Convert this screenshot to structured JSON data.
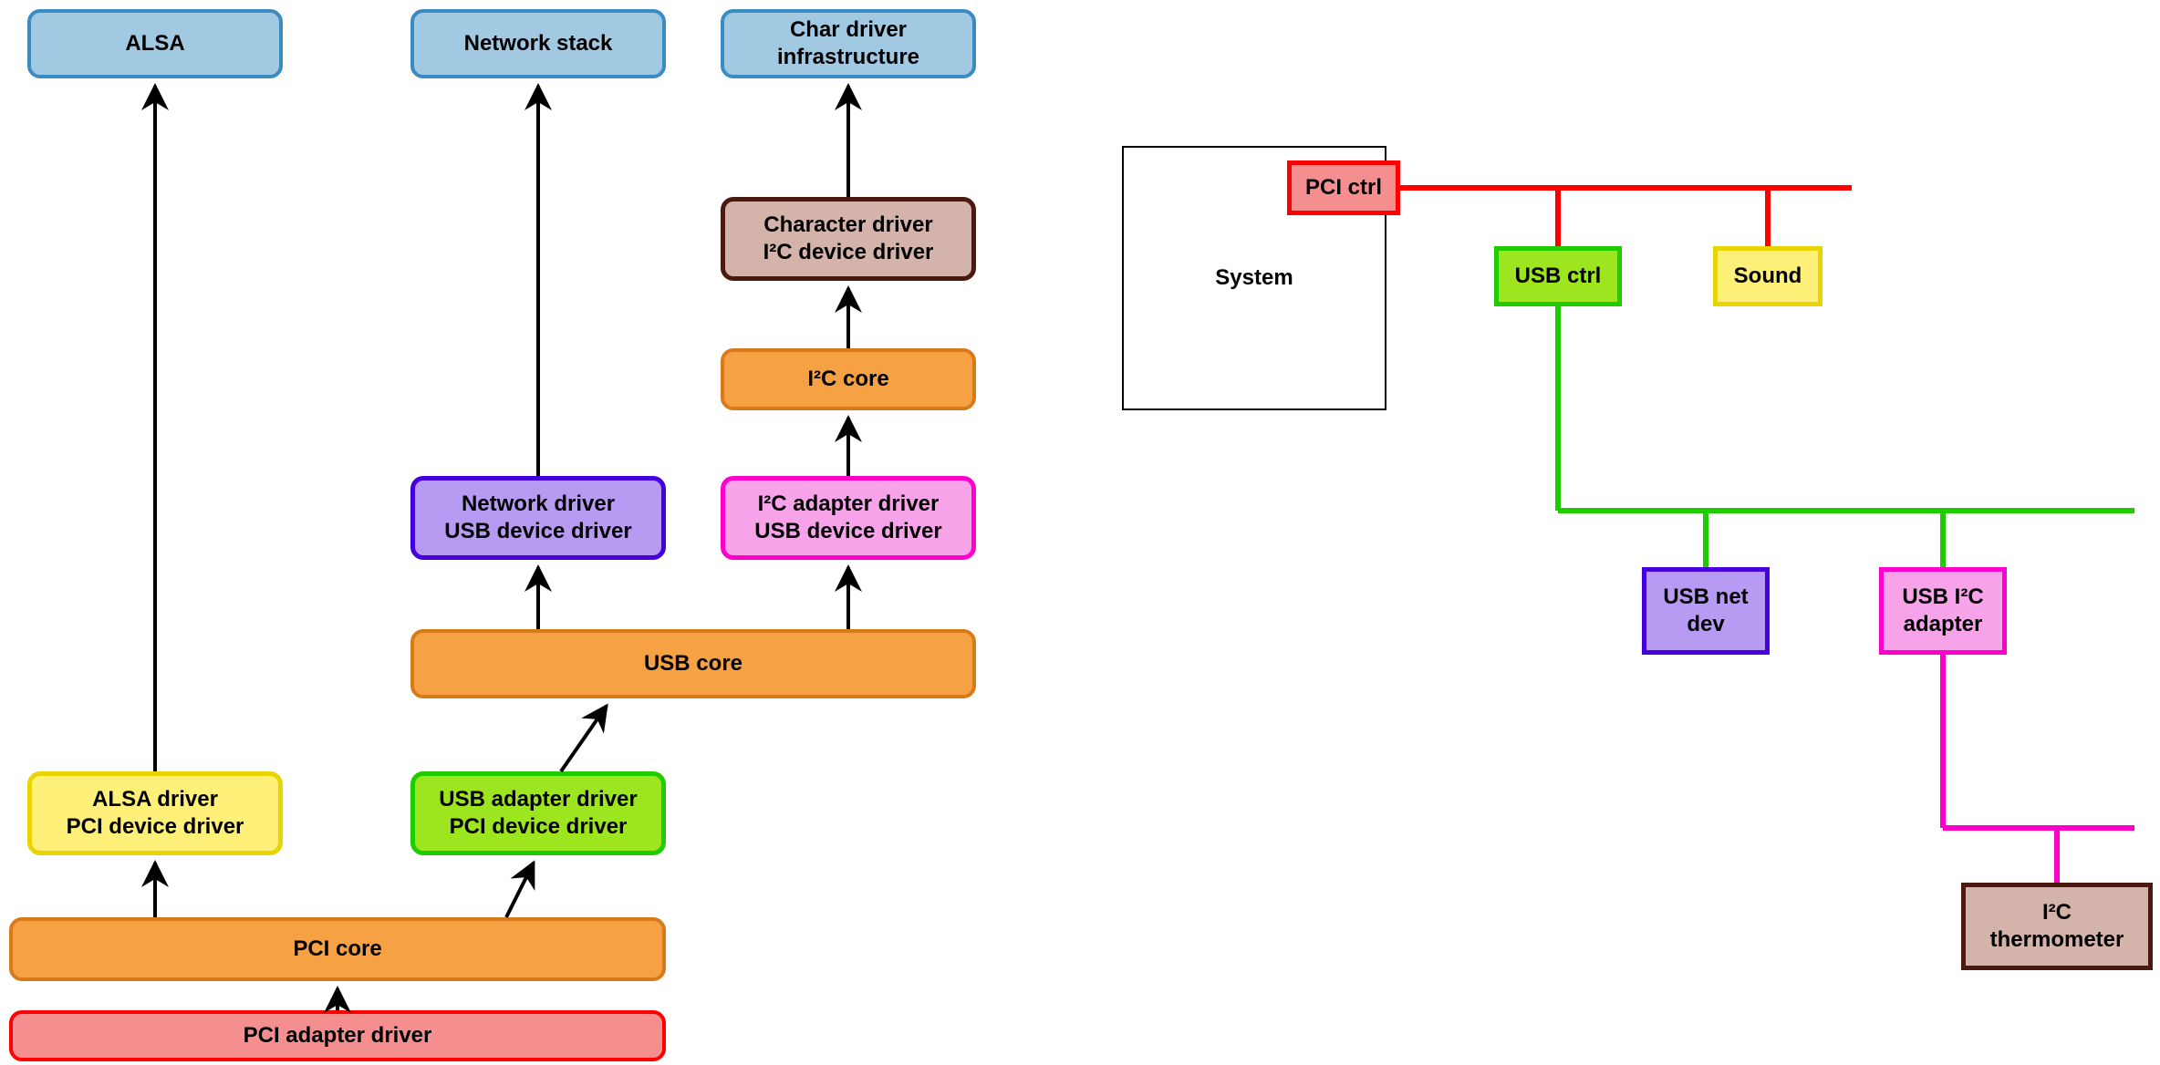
{
  "left": {
    "alsa": "ALSA",
    "network_stack": "Network stack",
    "char_driver_l1": "Char driver",
    "char_driver_l2": "infrastructure",
    "char_dev_l1": "Character driver",
    "char_dev_l2": "I²C device driver",
    "i2c_core": "I²C core",
    "net_drv_l1": "Network driver",
    "net_drv_l2": "USB device driver",
    "i2c_adapter_l1": "I²C adapter driver",
    "i2c_adapter_l2": "USB device driver",
    "usb_core": "USB core",
    "alsa_drv_l1": "ALSA driver",
    "alsa_drv_l2": "PCI device driver",
    "usb_adapter_l1": "USB adapter driver",
    "usb_adapter_l2": "PCI device driver",
    "pci_core": "PCI core",
    "pci_adapter": "PCI adapter driver"
  },
  "right": {
    "system": "System",
    "pci_ctrl": "PCI ctrl",
    "usb_ctrl": "USB ctrl",
    "sound": "Sound",
    "usb_net_l1": "USB net",
    "usb_net_l2": "dev",
    "usb_i2c_l1": "USB I²C",
    "usb_i2c_l2": "adapter",
    "i2c_therm_l1": "I²C",
    "i2c_therm_l2": "thermometer"
  },
  "colors": {
    "lightblue_fill": "#a1c9e1",
    "lightblue_stroke": "#3a8bc2",
    "orange_fill": "#f7a145",
    "orange_stroke": "#d97a1a",
    "red_fill": "#f58f8f",
    "red_stroke": "#ff0000",
    "yellow_fill": "#fff07a",
    "yellow_stroke": "#e8d400",
    "green_fill": "#9de61f",
    "green_stroke": "#1ecc00",
    "purple_fill": "#b79af1",
    "purple_stroke": "#4400dd",
    "magenta_fill": "#f7a3ea",
    "magenta_stroke": "#ff00cc",
    "brown_fill": "#d4b3aa",
    "brown_stroke": "#4a1a0f",
    "bus_red": "#ff0000",
    "bus_green": "#1ecc00",
    "bus_magenta": "#ff00cc"
  }
}
